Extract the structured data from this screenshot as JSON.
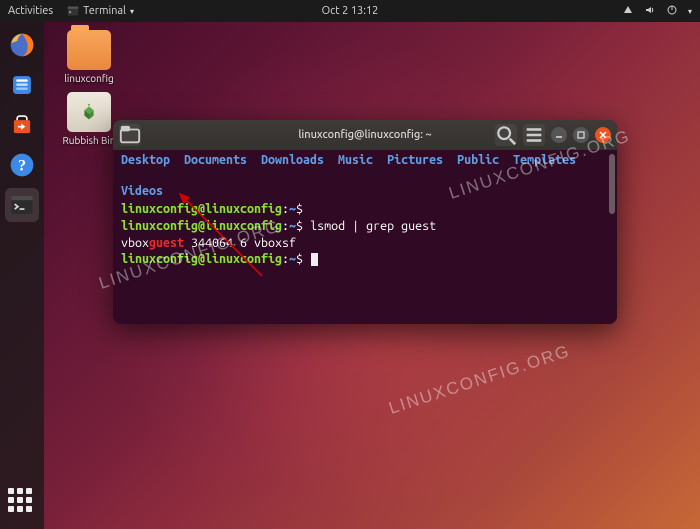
{
  "topbar": {
    "activities": "Activities",
    "app_label": "Terminal",
    "datetime": "Oct 2  13:12"
  },
  "dock": {
    "items": [
      {
        "name": "firefox"
      },
      {
        "name": "files"
      },
      {
        "name": "software"
      },
      {
        "name": "help"
      },
      {
        "name": "terminal",
        "active": true
      }
    ]
  },
  "desktop_icons": {
    "folder_label": "linuxconfig",
    "trash_label": "Rubbish Bin"
  },
  "terminal": {
    "title": "linuxconfig@linuxconfig: ~",
    "dirs": [
      "Desktop",
      "Documents",
      "Downloads",
      "Music",
      "Pictures",
      "Public",
      "Templates",
      "Videos"
    ],
    "prompt_user": "linuxconfig@linuxconfig",
    "prompt_sep": ":",
    "prompt_path": "~",
    "prompt_dollar": "$",
    "lines": {
      "cmd1": "",
      "cmd2": "lsmod | grep guest",
      "out_pre": "vbox",
      "out_match": "guest",
      "out_post": "              344064  6 vboxsf"
    }
  },
  "watermark": "LINUXCONFIG.ORG"
}
